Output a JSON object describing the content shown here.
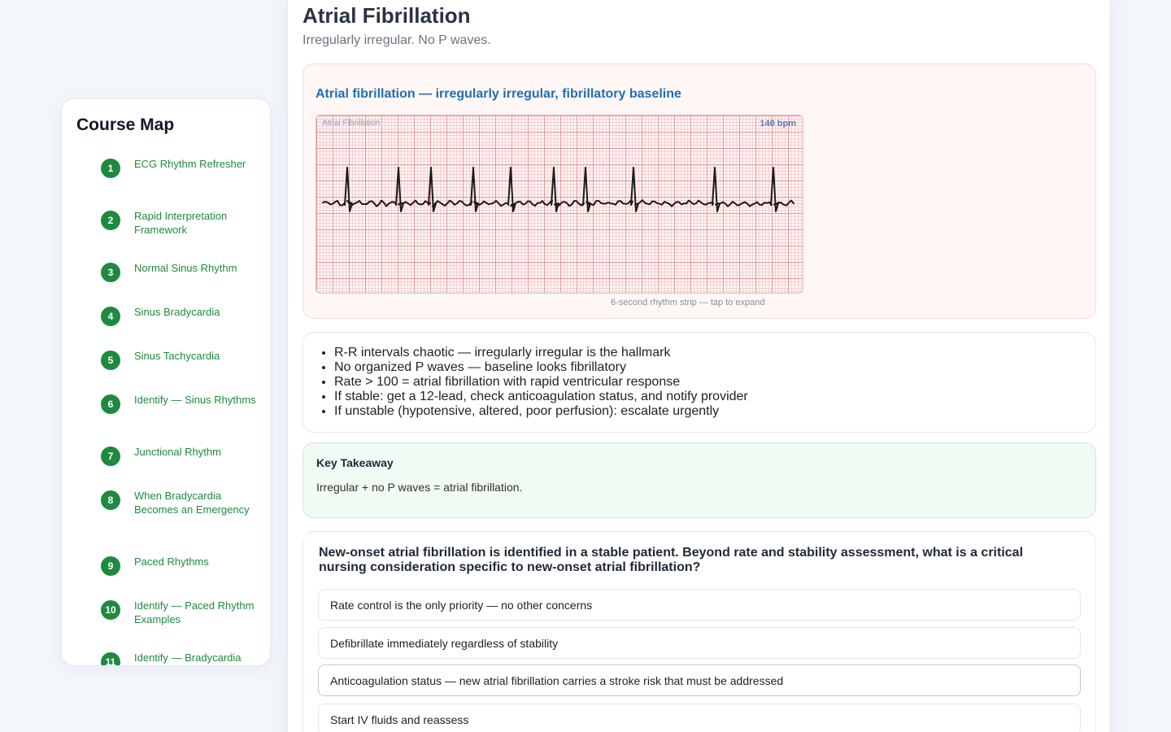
{
  "sidebar": {
    "title": "Course Map",
    "items": [
      {
        "num": "1",
        "label": "ECG Rhythm Refresher"
      },
      {
        "num": "2",
        "label": "Rapid Interpretation Framework"
      },
      {
        "num": "3",
        "label": "Normal Sinus Rhythm"
      },
      {
        "num": "4",
        "label": "Sinus Bradycardia"
      },
      {
        "num": "5",
        "label": "Sinus Tachycardia"
      },
      {
        "num": "6",
        "label": "Identify — Sinus Rhythms"
      },
      {
        "num": "7",
        "label": "Junctional Rhythm"
      },
      {
        "num": "8",
        "label": "When Bradycardia Becomes an Emergency"
      },
      {
        "num": "9",
        "label": "Paced Rhythms"
      },
      {
        "num": "10",
        "label": "Identify — Paced Rhythm Examples"
      },
      {
        "num": "11",
        "label": "Identify — Bradycardia"
      }
    ]
  },
  "lesson": {
    "title": "Atrial Fibrillation",
    "subtitle": "Irregularly irregular. No P waves."
  },
  "strip": {
    "heading": "Atrial fibrillation — irregularly irregular, fibrillatory baseline",
    "label": "Atrial Fibrillation",
    "rate": "140 bpm",
    "caption": "6-second rhythm strip — tap to expand"
  },
  "key_points": [
    "R-R intervals chaotic — irregularly irregular is the hallmark",
    "No organized P waves — baseline looks fibrillatory",
    "Rate > 100 = atrial fibrillation with rapid ventricular response",
    "If stable: get a 12-lead, check anticoagulation status, and notify provider",
    "If unstable (hypotensive, altered, poor perfusion): escalate urgently"
  ],
  "takeaway": {
    "title": "Key Takeaway",
    "text": "Irregular + no P waves = atrial fibrillation."
  },
  "quiz": {
    "question": "New-onset atrial fibrillation is identified in a stable patient. Beyond rate and stability assessment, what is a critical nursing consideration specific to new-onset atrial fibrillation?",
    "options": [
      "Rate control is the only priority — no other concerns",
      "Defibrillate immediately regardless of stability",
      "Anticoagulation status — new atrial fibrillation carries a stroke risk that must be addressed",
      "Start IV fluids and reassess"
    ]
  },
  "colors": {
    "accent_green": "#1f8a3f",
    "accent_blue": "#1f6fb2",
    "ecg_trace": "#1a1a1a"
  }
}
